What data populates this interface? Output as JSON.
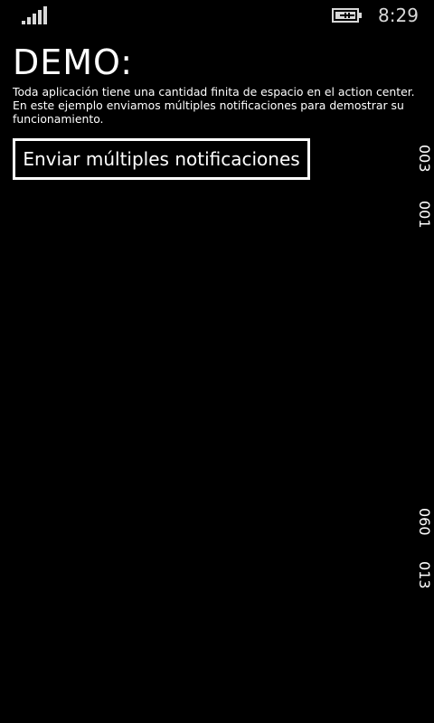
{
  "status_bar": {
    "signal_icon": "signal-strength-icon",
    "battery_icon": "battery-charging-icon",
    "time": "8:29"
  },
  "app": {
    "title": "DEMO:",
    "description": "Toda aplicación tiene una cantidad finita de espacio en el action center. En este ejemplo enviamos múltiples notificaciones para demostrar su funcionamiento.",
    "button_label": "Enviar múltiples notificaciones"
  },
  "debug_counters": [
    "003",
    "001",
    "060",
    "013"
  ]
}
